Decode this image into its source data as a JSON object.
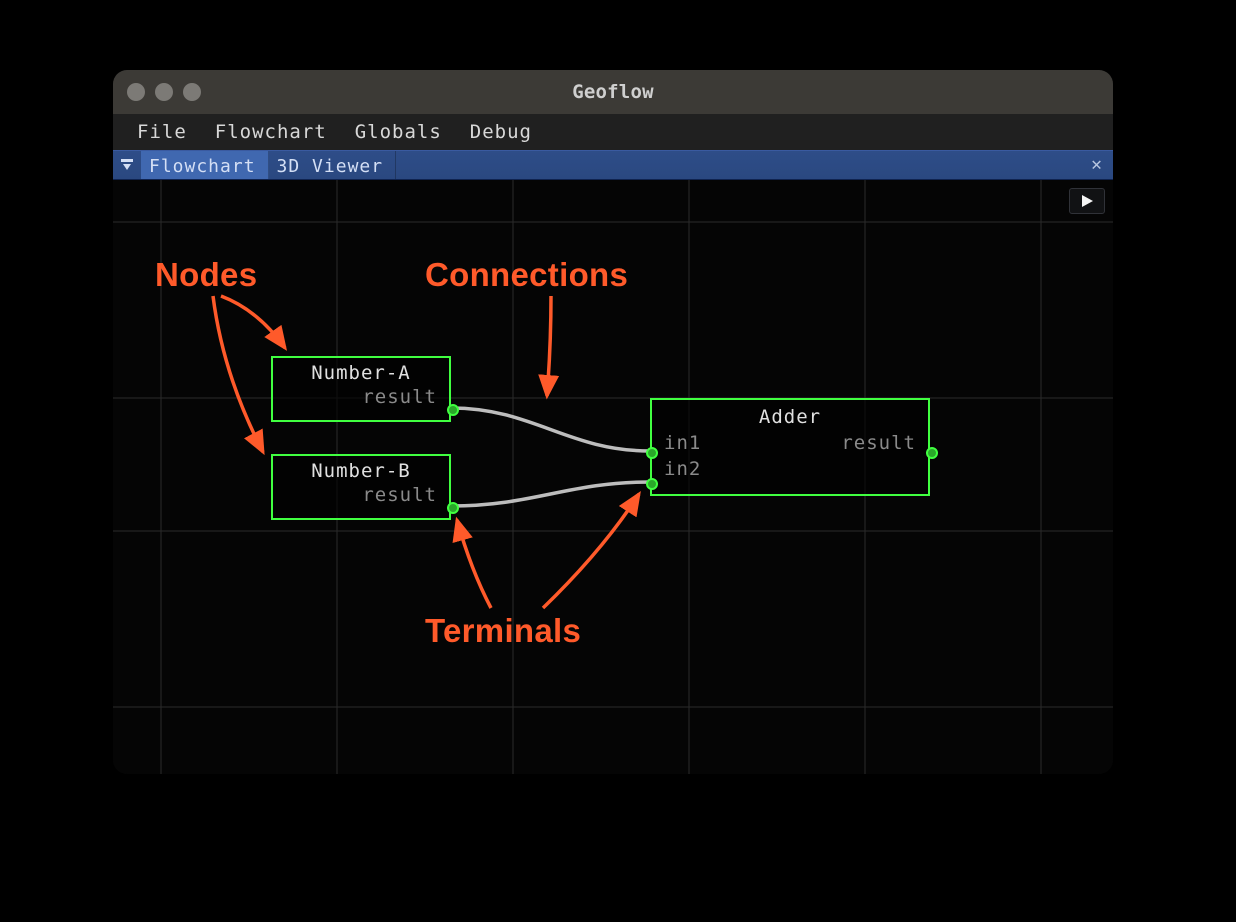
{
  "window": {
    "title": "Geoflow"
  },
  "menubar": {
    "items": [
      "File",
      "Flowchart",
      "Globals",
      "Debug"
    ]
  },
  "tabs": {
    "items": [
      {
        "label": "Flowchart",
        "active": true
      },
      {
        "label": "3D Viewer",
        "active": false
      }
    ]
  },
  "nodes": {
    "a": {
      "title": "Number-A",
      "out_label": "result"
    },
    "b": {
      "title": "Number-B",
      "out_label": "result"
    },
    "adder": {
      "title": "Adder",
      "in1": "in1",
      "in2": "in2",
      "out_label": "result"
    }
  },
  "annotations": {
    "nodes": "Nodes",
    "connections": "Connections",
    "terminals": "Terminals"
  },
  "colors": {
    "accent_green": "#40ff40",
    "annotation_red": "#ff5a2a",
    "tabbar_blue": "#2e4d88"
  }
}
